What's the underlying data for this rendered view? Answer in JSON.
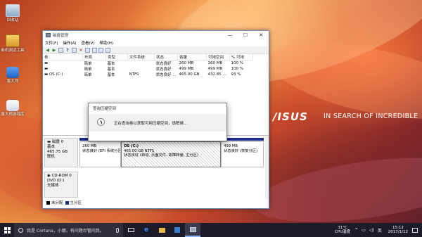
{
  "desktop": {
    "icons": [
      {
        "label": "回收站"
      },
      {
        "label": "新机测试工具"
      },
      {
        "label": "鲁大师"
      },
      {
        "label": "鲁大师游戏库"
      }
    ],
    "brand": "/ISUS",
    "tagline": "IN SEARCH OF INCREDIBLE"
  },
  "window": {
    "title": "磁盘管理",
    "controls": {
      "minimize": "—",
      "maximize": "☐",
      "close": "✕"
    },
    "menu": [
      "文件(F)",
      "操作(A)",
      "查看(V)",
      "帮助(H)"
    ],
    "volume_table": {
      "headers": [
        "卷",
        "布局",
        "类型",
        "文件系统",
        "状态",
        "容量",
        "可用空间",
        "% 可用"
      ],
      "rows": [
        [
          "",
          "简单",
          "基本",
          "",
          "状态良好",
          "260 MB",
          "260 MB",
          "100 %"
        ],
        [
          "",
          "简单",
          "基本",
          "",
          "状态良好",
          "499 MB",
          "499 MB",
          "100 %"
        ],
        [
          "OS (C:)",
          "简单",
          "基本",
          "NTFS",
          "状态良好 ...",
          "465.00 GB",
          "432.85 ...",
          "93 %"
        ]
      ]
    },
    "disks": [
      {
        "name": "磁盘 0",
        "type": "基本",
        "size": "465.75 GB",
        "status": "联机",
        "partitions": [
          {
            "title": "",
            "line1": "260 MB",
            "line2": "状态良好 (EFI 系统分区)"
          },
          {
            "title": "OS  (C:)",
            "line1": "465.00 GB NTFS",
            "line2": "状态良好 (启动, 页面文件, 故障转储, 主分区)"
          },
          {
            "title": "",
            "line1": "499 MB",
            "line2": "状态良好 (恢复分区)"
          }
        ]
      },
      {
        "name": "CD-ROM 0",
        "type": "DVD (D:)",
        "size": "",
        "status": "无媒体"
      }
    ],
    "legend": [
      {
        "label": "未分配",
        "color": "#000000"
      },
      {
        "label": "主分区",
        "color": "#1a2a8c"
      }
    ]
  },
  "dialog": {
    "title": "查询压缩空间",
    "message": "正在查询卷以获取可用压缩空间，请稍候..."
  },
  "taskbar": {
    "search_placeholder": "我是 Cortana，小娜。有问题尽管问我。",
    "temperature": "31°C",
    "temperature_label": "CPU温度",
    "ime": "英",
    "time": "15:12",
    "date": "2017/1/12"
  }
}
